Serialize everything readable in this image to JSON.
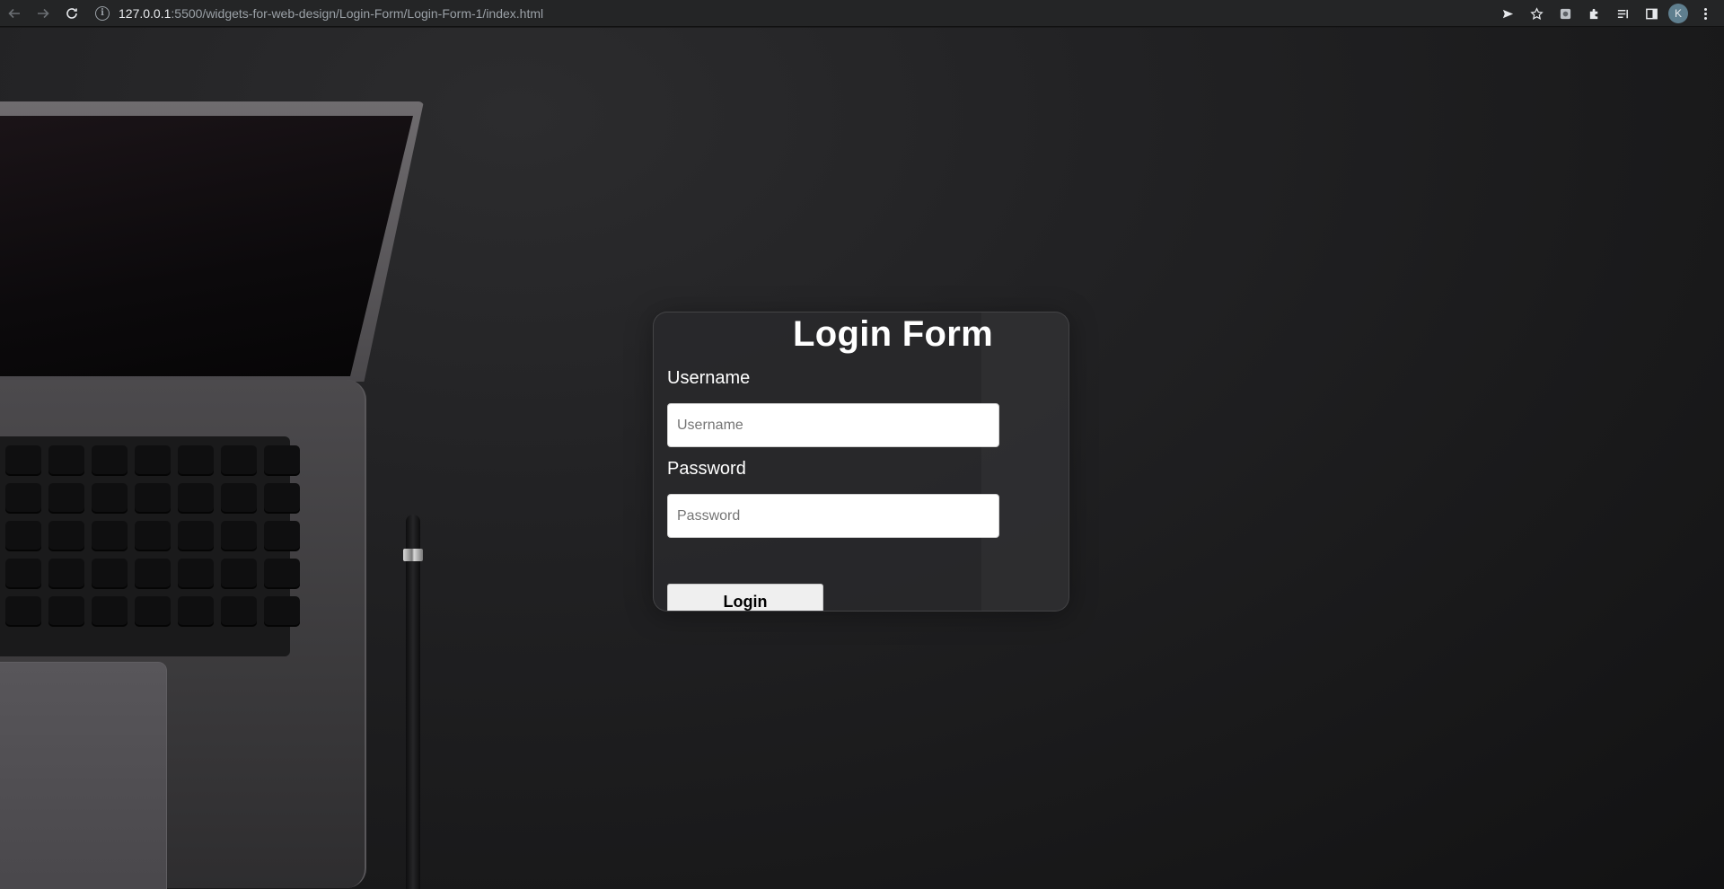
{
  "browser": {
    "url_host": "127.0.0.1",
    "url_path": ":5500/widgets-for-web-design/Login-Form/Login-Form-1/index.html",
    "profile_initial": "K"
  },
  "login_form": {
    "title": "Login Form",
    "username_label": "Username",
    "username_placeholder": "Username",
    "username_value": "",
    "password_label": "Password",
    "password_placeholder": "Password",
    "password_value": "",
    "login_button": "Login"
  },
  "icons": {
    "back": "arrow-left-icon",
    "forward": "arrow-right-icon",
    "reload": "reload-icon",
    "site_info": "info-icon",
    "send": "send-icon",
    "bookmark": "star-icon",
    "extension": "extension-icon",
    "puzzle": "puzzle-icon",
    "reading_list": "reading-list-icon",
    "side_panel": "side-panel-icon",
    "menu": "more-vert-icon"
  },
  "colors": {
    "page_background": "#1a1a1b",
    "card_background": "#2a2a2c",
    "text": "#ffffff"
  }
}
